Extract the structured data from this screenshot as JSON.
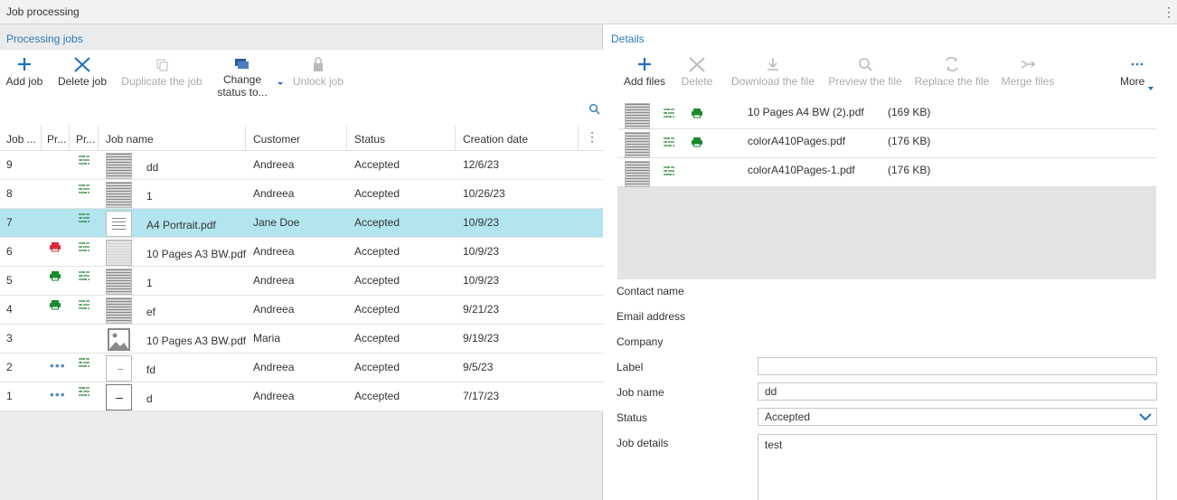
{
  "app": {
    "title": "Job processing"
  },
  "left": {
    "section_title": "Processing jobs",
    "toolbar": {
      "add_job": "Add job",
      "delete_job": "Delete job",
      "duplicate_job": "Duplicate the job",
      "change_status_line1": "Change",
      "change_status_line2": "status to...",
      "unlock_job": "Unlock job"
    },
    "columns": [
      "Job ...",
      "Pr...",
      "Pr...",
      "Job name",
      "Customer",
      "Status",
      "Creation date"
    ],
    "rows": [
      {
        "job": "9",
        "printer": "none",
        "processed": true,
        "thumb": "lines",
        "name": "dd",
        "customer": "Andreea",
        "status": "Accepted",
        "date": "12/6/23"
      },
      {
        "job": "8",
        "printer": "none",
        "processed": true,
        "thumb": "lines",
        "name": "1",
        "customer": "Andreea",
        "status": "Accepted",
        "date": "10/26/23"
      },
      {
        "job": "7",
        "printer": "none",
        "processed": true,
        "thumb": "doc",
        "name": "A4 Portrait.pdf",
        "customer": "Jane Doe",
        "status": "Accepted",
        "date": "10/9/23"
      },
      {
        "job": "6",
        "printer": "red",
        "processed": true,
        "thumb": "grey",
        "name": "10 Pages A3 BW.pdf",
        "customer": "Andreea",
        "status": "Accepted",
        "date": "10/9/23"
      },
      {
        "job": "5",
        "printer": "green",
        "processed": true,
        "thumb": "lines",
        "name": "1",
        "customer": "Andreea",
        "status": "Accepted",
        "date": "10/9/23"
      },
      {
        "job": "4",
        "printer": "green",
        "processed": true,
        "thumb": "lines",
        "name": "ef",
        "customer": "Andreea",
        "status": "Accepted",
        "date": "9/21/23"
      },
      {
        "job": "3",
        "printer": "none",
        "processed": false,
        "thumb": "image",
        "name": "10 Pages A3 BW.pdf",
        "customer": "Maria",
        "status": "Accepted",
        "date": "9/19/23"
      },
      {
        "job": "2",
        "printer": "dots",
        "processed": true,
        "thumb": "blank",
        "name": "fd",
        "customer": "Andreea",
        "status": "Accepted",
        "date": "9/5/23"
      },
      {
        "job": "1",
        "printer": "dots",
        "processed": true,
        "thumb": "dash",
        "name": "d",
        "customer": "Andreea",
        "status": "Accepted",
        "date": "7/17/23"
      }
    ],
    "selected_row_index": 2
  },
  "right": {
    "section_title": "Details",
    "toolbar": {
      "add_files": "Add files",
      "delete": "Delete",
      "download": "Download the file",
      "preview": "Preview the file",
      "replace": "Replace the file",
      "merge": "Merge files",
      "more": "More"
    },
    "files": [
      {
        "name": "10 Pages A4 BW (2).pdf",
        "size": "(169 KB)",
        "printer": "green"
      },
      {
        "name": "colorA410Pages.pdf",
        "size": "(176 KB)",
        "printer": "green"
      },
      {
        "name": "colorA410Pages-1.pdf",
        "size": "(176 KB)",
        "printer": "none"
      }
    ],
    "form": {
      "contact_name_label": "Contact name",
      "email_label": "Email address",
      "company_label": "Company",
      "label_label": "Label",
      "label_value": "",
      "job_name_label": "Job name",
      "job_name_value": "dd",
      "status_label": "Status",
      "status_value": "Accepted",
      "job_details_label": "Job details",
      "job_details_value": "test"
    }
  },
  "colors": {
    "accent": "#2a7ab8",
    "selected_row": "#b3e5ef",
    "printer_green": "#1a8a2e",
    "printer_red": "#e0253a"
  }
}
